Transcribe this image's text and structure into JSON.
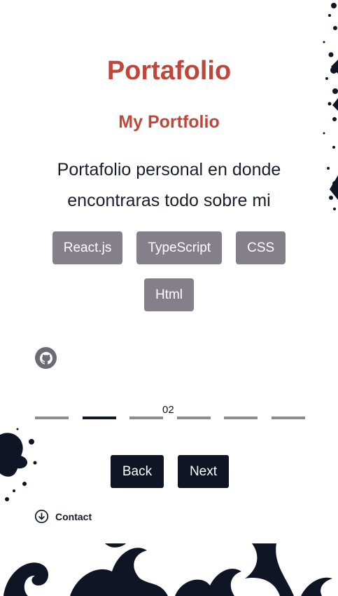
{
  "header": {
    "title": "Portafolio",
    "subtitle": "My Portfolio"
  },
  "description": "Portafolio personal en donde encontraras todo sobre mi",
  "tags": [
    "React.js",
    "TypeScript",
    "CSS",
    "Html"
  ],
  "icons": {
    "github": "github-icon",
    "contact": "arrow-down-circle-icon"
  },
  "pagination": {
    "current": "02",
    "total_segments": 6,
    "active_index": 1
  },
  "nav": {
    "back_label": "Back",
    "next_label": "Next"
  },
  "contact": {
    "label": "Contact"
  },
  "colors": {
    "accent": "#c0463a",
    "dark": "#0f1524",
    "tag_bg": "#857f8a",
    "segment": "#8c8c8c"
  }
}
